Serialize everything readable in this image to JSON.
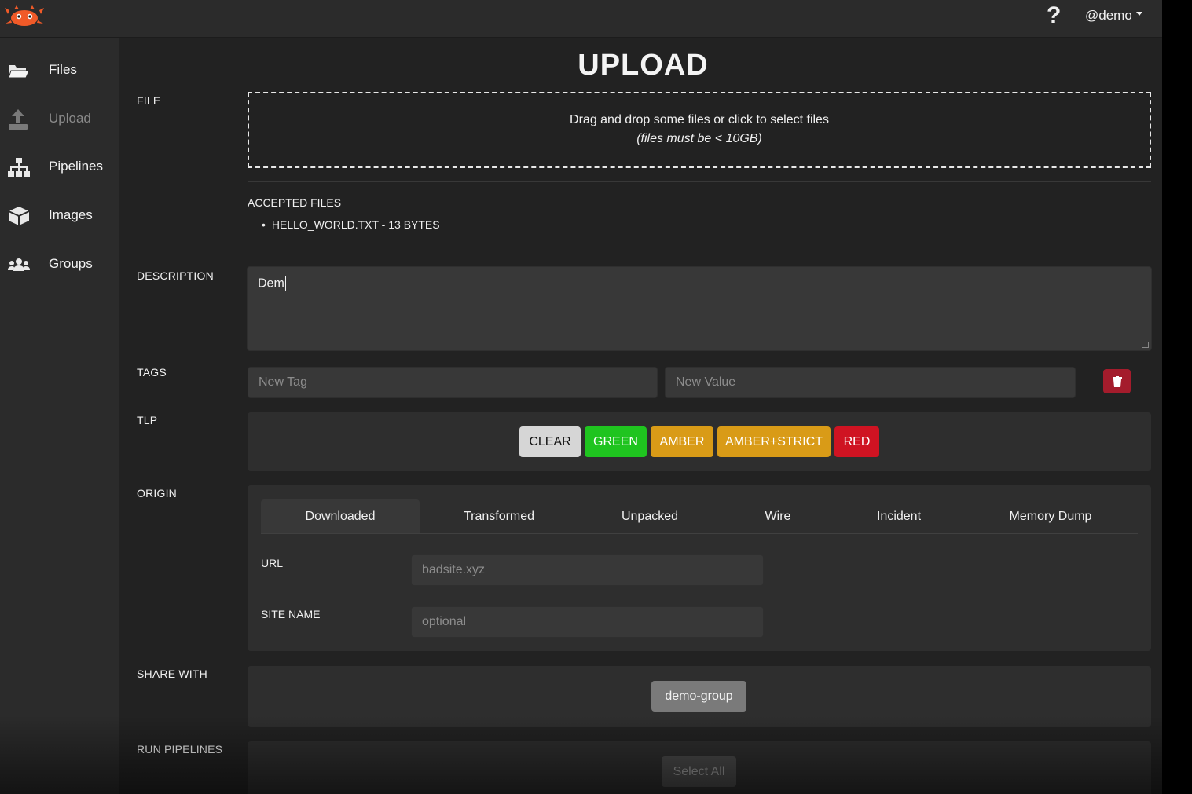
{
  "header": {
    "help_glyph": "?",
    "user_label": "@demo"
  },
  "sidebar": {
    "items": [
      {
        "label": "Files",
        "icon": "folder-open-icon",
        "active": false,
        "disabled": false
      },
      {
        "label": "Upload",
        "icon": "upload-icon",
        "active": true,
        "disabled": true
      },
      {
        "label": "Pipelines",
        "icon": "sitemap-icon",
        "active": false,
        "disabled": false
      },
      {
        "label": "Images",
        "icon": "cube-icon",
        "active": false,
        "disabled": false
      },
      {
        "label": "Groups",
        "icon": "users-icon",
        "active": false,
        "disabled": false
      }
    ]
  },
  "page": {
    "title": "UPLOAD"
  },
  "file": {
    "label": "FILE",
    "dropzone_line1": "Drag and drop some files or click to select files",
    "dropzone_line2": "(files must be < 10GB)",
    "accepted_title": "ACCEPTED FILES",
    "accepted_files": [
      "HELLO_WORLD.TXT - 13 BYTES"
    ]
  },
  "description": {
    "label": "DESCRIPTION",
    "value": "Dem"
  },
  "tags": {
    "label": "TAGS",
    "tag_placeholder": "New Tag",
    "value_placeholder": "New Value",
    "delete_icon": "trash-icon"
  },
  "tlp": {
    "label": "TLP",
    "options": [
      {
        "label": "CLEAR",
        "color": "#d6d6d6",
        "text_color": "#111111"
      },
      {
        "label": "GREEN",
        "color": "#1fc41f",
        "text_color": "#ffffff"
      },
      {
        "label": "AMBER",
        "color": "#d99b17",
        "text_color": "#ffffff"
      },
      {
        "label": "AMBER+STRICT",
        "color": "#d99b17",
        "text_color": "#ffffff"
      },
      {
        "label": "RED",
        "color": "#cf1322",
        "text_color": "#ffffff"
      }
    ]
  },
  "origin": {
    "label": "ORIGIN",
    "tabs": [
      "Downloaded",
      "Transformed",
      "Unpacked",
      "Wire",
      "Incident",
      "Memory Dump"
    ],
    "active_tab": "Downloaded",
    "url_label": "URL",
    "url_placeholder": "badsite.xyz",
    "site_name_label": "SITE NAME",
    "site_name_placeholder": "optional"
  },
  "share_with": {
    "label": "SHARE WITH",
    "groups": [
      "demo-group"
    ]
  },
  "run_pipelines": {
    "label": "RUN PIPELINES",
    "select_all_label": "Select All"
  }
}
